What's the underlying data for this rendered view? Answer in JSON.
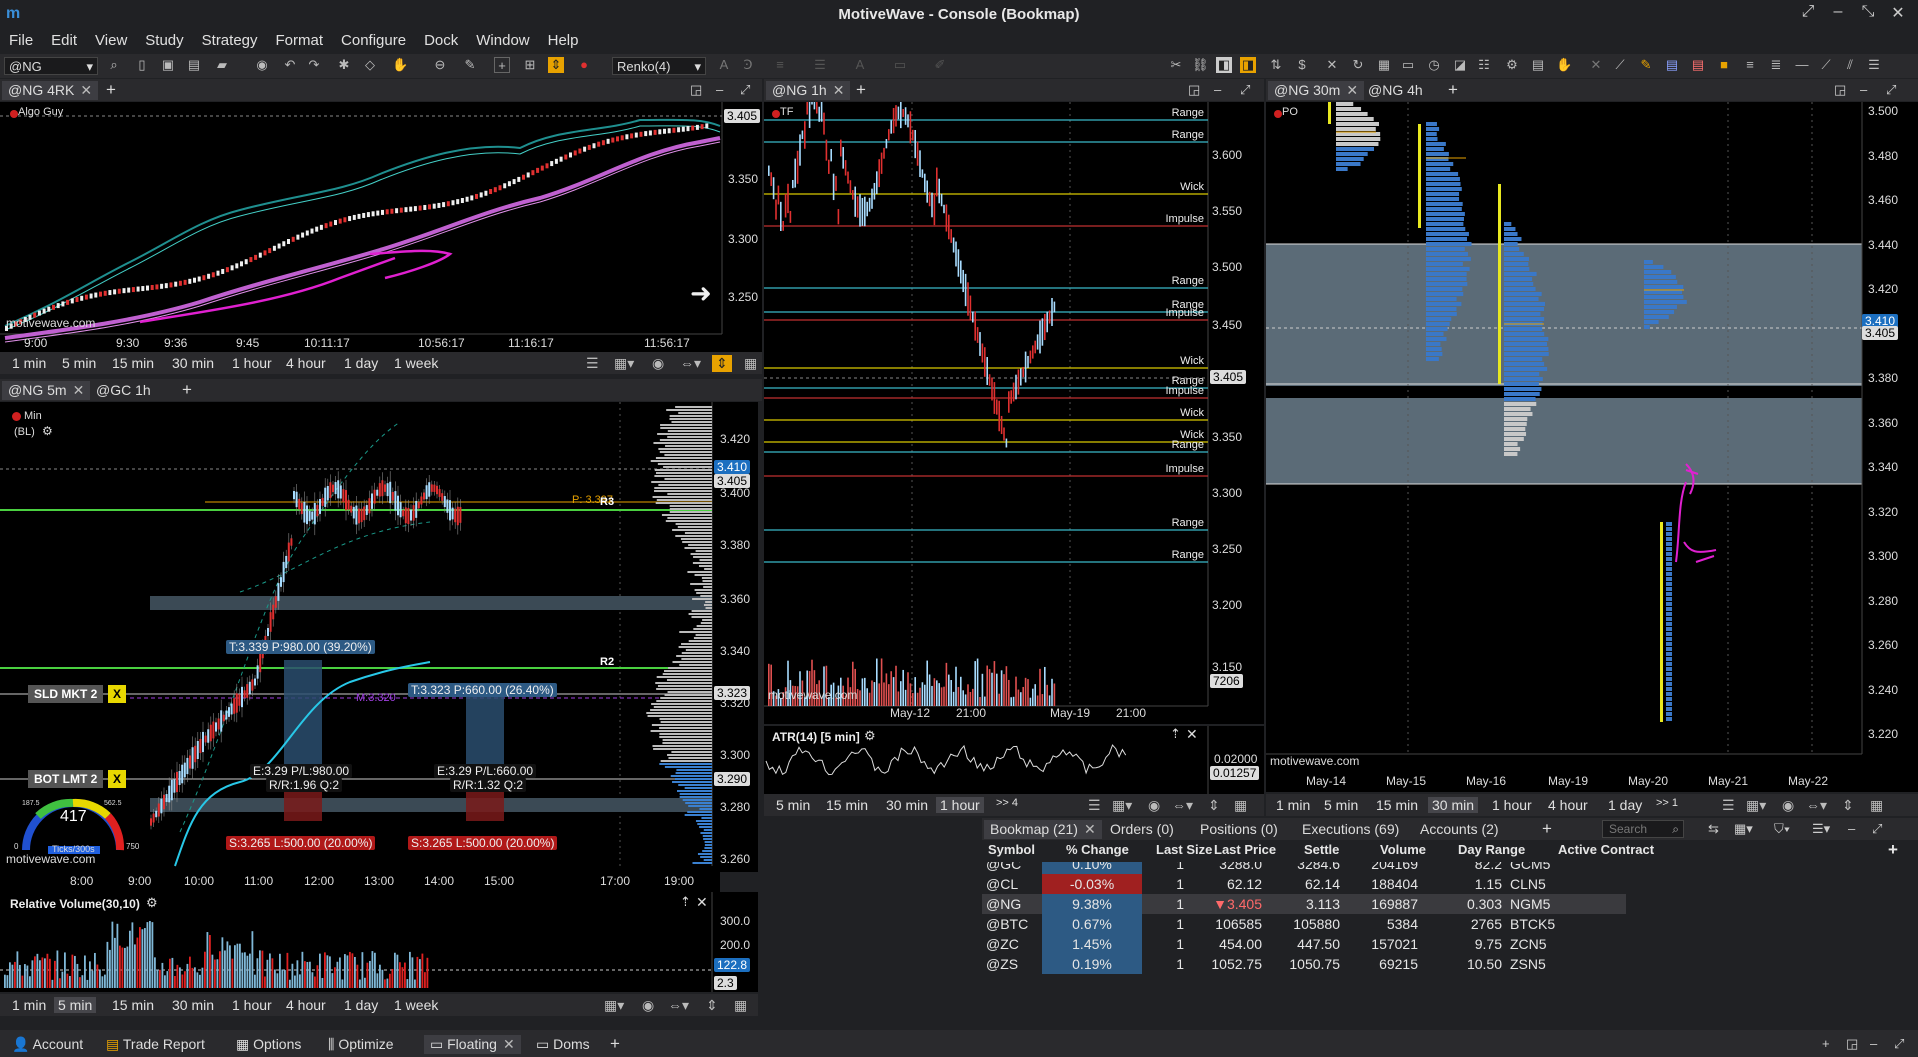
{
  "app": {
    "title": "MotiveWave - Console (Bookmap)",
    "logo": "m"
  },
  "menu": [
    "File",
    "Edit",
    "View",
    "Study",
    "Strategy",
    "Format",
    "Configure",
    "Dock",
    "Window",
    "Help"
  ],
  "toolbar": {
    "symbol": "@NG",
    "bar_type": "Renko(4)"
  },
  "p1": {
    "tabs": [
      "@NG 4RK"
    ],
    "label": "Algo Guy",
    "price": "3.405",
    "yticks": [
      "3.350",
      "3.300",
      "3.250"
    ],
    "xticks": [
      "9:00",
      "9:30",
      "9:36",
      "9:45",
      "10:11:17",
      "10:56:17",
      "11:16:17",
      "11:56:17"
    ],
    "watermark": "motivewave.com",
    "periods": [
      "1 min",
      "5 min",
      "15 min",
      "30 min",
      "1 hour",
      "4 hour",
      "1 day",
      "1 week"
    ]
  },
  "p2": {
    "tabs": [
      "@NG 5m",
      "@GC 1h"
    ],
    "label": "Min",
    "label2": "(BL)",
    "yticks": [
      "3.420",
      "3.400",
      "3.380",
      "3.360",
      "3.340",
      "3.320",
      "3.300",
      "3.280",
      "3.260"
    ],
    "price_tags": [
      "3.410",
      "3.405",
      "3.323",
      "3.290"
    ],
    "xticks": [
      "8:00",
      "9:00",
      "10:00",
      "11:00",
      "12:00",
      "13:00",
      "14:00",
      "15:00",
      "17:00",
      "19:00"
    ],
    "pivot": "P: 3.397",
    "r3": "R3",
    "r2": "R2",
    "m3": "M:3.320",
    "orders": [
      {
        "label": "SLD MKT 2",
        "x": "X"
      },
      {
        "label": "BOT LMT 2",
        "x": "X"
      }
    ],
    "trades": [
      {
        "t": "T:3.339 P:980.00 (39.20%)",
        "e": "E:3.29 P/L:980.00",
        "rr": "R/R:1.96 Q:2",
        "s": "S:3.265 L:500.00 (20.00%)"
      },
      {
        "t": "T:3.323 P:660.00 (26.40%)",
        "e": "E:3.29 P/L:660.00",
        "rr": "R/R:1.32 Q:2",
        "s": "S:3.265 L:500.00 (20.00%)"
      }
    ],
    "gauge": {
      "value": "417",
      "unit": "Ticks/300s",
      "min": "0",
      "max": "750",
      "l1": "187.5",
      "l2": "562.5"
    },
    "watermark": "motivewave.com"
  },
  "rv": {
    "title": "Relative Volume(30,10)",
    "yticks": [
      "300.0",
      "200.0",
      "100.0"
    ],
    "tag1": "122.8",
    "tag2": "2.3",
    "periods": [
      "1 min",
      "5 min",
      "15 min",
      "30 min",
      "1 hour",
      "4 hour",
      "1 day",
      "1 week"
    ],
    "active": "5 min"
  },
  "p3": {
    "tabs": [
      "@NG 1h"
    ],
    "label": "TF",
    "yticks": [
      "3.600",
      "3.550",
      "3.500",
      "3.450",
      "3.400",
      "3.350",
      "3.300",
      "3.250",
      "3.200",
      "3.150"
    ],
    "price": "3.405",
    "vol": "7206",
    "levels": [
      "Range",
      "Range",
      "Wick",
      "Impulse",
      "Range",
      "Range",
      "Impulse",
      "Wick",
      "Range",
      "Impulse",
      "Wick",
      "Wick",
      "Range",
      "Impulse",
      "Range",
      "Range"
    ],
    "xticks": [
      "May-12",
      "21:00",
      "May-19",
      "21:00"
    ],
    "watermark": "motivewave.com",
    "atr": {
      "title": "ATR(14) [5 min]",
      "v1": "0.02000",
      "v2": "0.01257"
    },
    "periods": [
      "5 min",
      "15 min",
      "30 min",
      "1 hour",
      ">> 4"
    ],
    "active": "1 hour"
  },
  "p4": {
    "tabs": [
      "@NG 30m",
      "@NG 4h"
    ],
    "label": "PO",
    "yticks": [
      "3.500",
      "3.480",
      "3.460",
      "3.440",
      "3.420",
      "3.400",
      "3.380",
      "3.360",
      "3.340",
      "3.320",
      "3.300",
      "3.280",
      "3.260",
      "3.240",
      "3.220"
    ],
    "tag1": "3.410",
    "tag2": "3.405",
    "xticks": [
      "May-14",
      "May-15",
      "May-16",
      "May-19",
      "May-20",
      "May-21",
      "May-22"
    ],
    "watermark": "motivewave.com",
    "periods": [
      "1 min",
      "5 min",
      "15 min",
      "30 min",
      "1 hour",
      "4 hour",
      "1 day",
      ">> 1"
    ],
    "active": "30 min"
  },
  "watchlist": {
    "tabs": [
      "Bookmap (21)",
      "Orders (0)",
      "Positions (0)",
      "Executions (69)",
      "Accounts (2)"
    ],
    "search": "Search",
    "columns": [
      "Symbol",
      "% Change",
      "Last Size",
      "Last Price",
      "Settle",
      "Volume",
      "Day Range",
      "Active Contract"
    ],
    "rows": [
      [
        "@GC",
        "0.10%",
        "1",
        "3288.0",
        "3284.6",
        "204169",
        "82.2",
        "GCM5"
      ],
      [
        "@CL",
        "-0.03%",
        "1",
        "62.12",
        "62.14",
        "188404",
        "1.15",
        "CLN5"
      ],
      [
        "@NG",
        "9.38%",
        "1",
        "▼3.405",
        "3.113",
        "169887",
        "0.303",
        "NGM5"
      ],
      [
        "@BTC",
        "0.67%",
        "1",
        "106585",
        "105880",
        "5384",
        "2765",
        "BTCK5"
      ],
      [
        "@ZC",
        "1.45%",
        "1",
        "454.00",
        "447.50",
        "157021",
        "9.75",
        "ZCN5"
      ],
      [
        "@ZS",
        "0.19%",
        "1",
        "1052.75",
        "1050.75",
        "69215",
        "10.50",
        "ZSN5"
      ]
    ]
  },
  "bottom": {
    "tabs": [
      "Account",
      "Trade Report",
      "Options",
      "Optimize",
      "Floating",
      "Doms"
    ]
  }
}
